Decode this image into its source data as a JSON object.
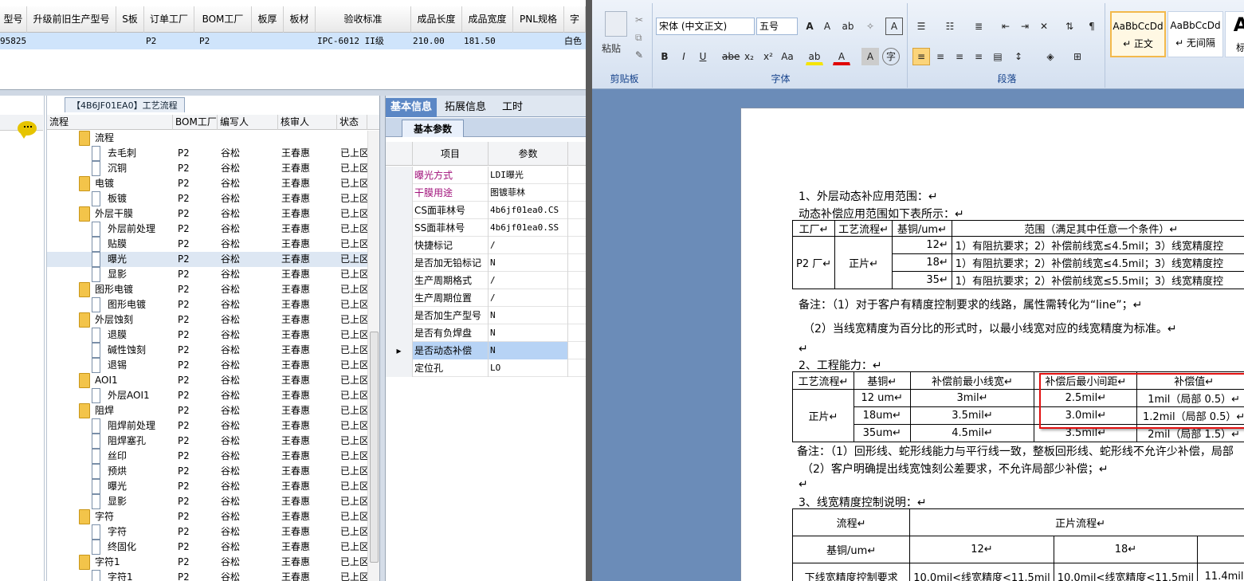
{
  "top_grid": {
    "columns": [
      "型号",
      "升级前旧生产型号",
      "S板",
      "订单工厂",
      "BOM工厂",
      "板厚",
      "板材",
      "验收标准",
      "成品长度",
      "成品宽度",
      "PNL规格",
      "字"
    ],
    "row": {
      "col0": "95825",
      "s_board": "",
      "order_factory": "P2",
      "bom_factory": "P2",
      "standard": "IPC-6012 II级",
      "length": "210.00",
      "width": "181.50",
      "tail": "白色"
    }
  },
  "process_tree": {
    "tab_title": "【4B6JF01EA0】工艺流程",
    "columns": [
      "流程",
      "BOM工厂",
      "编写人",
      "核审人",
      "状态"
    ],
    "rows": [
      {
        "name": "流程",
        "level": 0,
        "folder": true,
        "bom": "",
        "writer": "",
        "checker": "",
        "status": ""
      },
      {
        "name": "去毛刺",
        "level": 1,
        "folder": false,
        "bom": "P2",
        "writer": "谷松",
        "checker": "王春惠",
        "status": "已上区"
      },
      {
        "name": "沉铜",
        "level": 1,
        "folder": false,
        "bom": "P2",
        "writer": "谷松",
        "checker": "王春惠",
        "status": "已上区"
      },
      {
        "name": "电镀",
        "level": 0,
        "folder": true,
        "bom": "P2",
        "writer": "谷松",
        "checker": "王春惠",
        "status": "已上区"
      },
      {
        "name": "板镀",
        "level": 1,
        "folder": false,
        "bom": "P2",
        "writer": "谷松",
        "checker": "王春惠",
        "status": "已上区"
      },
      {
        "name": "外层干膜",
        "level": 0,
        "folder": true,
        "bom": "P2",
        "writer": "谷松",
        "checker": "王春惠",
        "status": "已上区"
      },
      {
        "name": "外层前处理",
        "level": 1,
        "folder": false,
        "bom": "P2",
        "writer": "谷松",
        "checker": "王春惠",
        "status": "已上区"
      },
      {
        "name": "贴膜",
        "level": 1,
        "folder": false,
        "bom": "P2",
        "writer": "谷松",
        "checker": "王春惠",
        "status": "已上区"
      },
      {
        "name": "曝光",
        "level": 1,
        "folder": false,
        "bom": "P2",
        "writer": "谷松",
        "checker": "王春惠",
        "status": "已上区",
        "selected": true
      },
      {
        "name": "显影",
        "level": 1,
        "folder": false,
        "bom": "P2",
        "writer": "谷松",
        "checker": "王春惠",
        "status": "已上区"
      },
      {
        "name": "图形电镀",
        "level": 0,
        "folder": true,
        "bom": "P2",
        "writer": "谷松",
        "checker": "王春惠",
        "status": "已上区"
      },
      {
        "name": "图形电镀",
        "level": 1,
        "folder": false,
        "bom": "P2",
        "writer": "谷松",
        "checker": "王春惠",
        "status": "已上区"
      },
      {
        "name": "外层蚀刻",
        "level": 0,
        "folder": true,
        "bom": "P2",
        "writer": "谷松",
        "checker": "王春惠",
        "status": "已上区"
      },
      {
        "name": "退膜",
        "level": 1,
        "folder": false,
        "bom": "P2",
        "writer": "谷松",
        "checker": "王春惠",
        "status": "已上区"
      },
      {
        "name": "碱性蚀刻",
        "level": 1,
        "folder": false,
        "bom": "P2",
        "writer": "谷松",
        "checker": "王春惠",
        "status": "已上区"
      },
      {
        "name": "退锡",
        "level": 1,
        "folder": false,
        "bom": "P2",
        "writer": "谷松",
        "checker": "王春惠",
        "status": "已上区"
      },
      {
        "name": "AOI1",
        "level": 0,
        "folder": true,
        "bom": "P2",
        "writer": "谷松",
        "checker": "王春惠",
        "status": "已上区"
      },
      {
        "name": "外层AOI1",
        "level": 1,
        "folder": false,
        "bom": "P2",
        "writer": "谷松",
        "checker": "王春惠",
        "status": "已上区"
      },
      {
        "name": "阻焊",
        "level": 0,
        "folder": true,
        "bom": "P2",
        "writer": "谷松",
        "checker": "王春惠",
        "status": "已上区"
      },
      {
        "name": "阻焊前处理",
        "level": 1,
        "folder": false,
        "bom": "P2",
        "writer": "谷松",
        "checker": "王春惠",
        "status": "已上区"
      },
      {
        "name": "阻焊塞孔",
        "level": 1,
        "folder": false,
        "bom": "P2",
        "writer": "谷松",
        "checker": "王春惠",
        "status": "已上区"
      },
      {
        "name": "丝印",
        "level": 1,
        "folder": false,
        "bom": "P2",
        "writer": "谷松",
        "checker": "王春惠",
        "status": "已上区"
      },
      {
        "name": "预烘",
        "level": 1,
        "folder": false,
        "bom": "P2",
        "writer": "谷松",
        "checker": "王春惠",
        "status": "已上区"
      },
      {
        "name": "曝光",
        "level": 1,
        "folder": false,
        "bom": "P2",
        "writer": "谷松",
        "checker": "王春惠",
        "status": "已上区"
      },
      {
        "name": "显影",
        "level": 1,
        "folder": false,
        "bom": "P2",
        "writer": "谷松",
        "checker": "王春惠",
        "status": "已上区"
      },
      {
        "name": "字符",
        "level": 0,
        "folder": true,
        "bom": "P2",
        "writer": "谷松",
        "checker": "王春惠",
        "status": "已上区"
      },
      {
        "name": "字符",
        "level": 1,
        "folder": false,
        "bom": "P2",
        "writer": "谷松",
        "checker": "王春惠",
        "status": "已上区"
      },
      {
        "name": "终固化",
        "level": 1,
        "folder": false,
        "bom": "P2",
        "writer": "谷松",
        "checker": "王春惠",
        "status": "已上区"
      },
      {
        "name": "字符1",
        "level": 0,
        "folder": true,
        "bom": "P2",
        "writer": "谷松",
        "checker": "王春惠",
        "status": "已上区"
      },
      {
        "name": "字符1",
        "level": 1,
        "folder": false,
        "bom": "P2",
        "writer": "谷松",
        "checker": "王春惠",
        "status": "已上区"
      }
    ]
  },
  "param_panel": {
    "tabs": [
      "基本信息",
      "拓展信息",
      "工时"
    ],
    "sub_tab": "基本参数",
    "columns": [
      "项目",
      "参数"
    ],
    "rows": [
      {
        "key": "曝光方式",
        "value": "LDI曝光",
        "key_color": "#a0107a"
      },
      {
        "key": "干膜用途",
        "value": "图镀菲林",
        "key_color": "#a0107a"
      },
      {
        "key": "CS面菲林号",
        "value": "4b6jf01ea0.CS"
      },
      {
        "key": "SS面菲林号",
        "value": "4b6jf01ea0.SS"
      },
      {
        "key": "快捷标记",
        "value": "/"
      },
      {
        "key": "是否加无铅标记",
        "value": "N"
      },
      {
        "key": "生产周期格式",
        "value": "/"
      },
      {
        "key": "生产周期位置",
        "value": "/"
      },
      {
        "key": "是否加生产型号",
        "value": "N"
      },
      {
        "key": "是否有负焊盘",
        "value": "N"
      },
      {
        "key": "是否动态补偿",
        "value": "N",
        "highlight": true
      },
      {
        "key": "定位孔",
        "value": "LO"
      }
    ]
  },
  "ribbon": {
    "paste_label": "粘贴",
    "clipboard_label": "剪贴板",
    "font_name": "宋体 (中文正文)",
    "font_size": "五号",
    "font_group_label": "字体",
    "paragraph_group_label": "段落",
    "styles": [
      {
        "sample": "AaBbCcDd",
        "name": "↵ 正文"
      },
      {
        "sample": "AaBbCcDd",
        "name": "↵ 无间隔"
      },
      {
        "sample": "A",
        "name": "标"
      }
    ],
    "colors": {
      "highlight": "#f5e400",
      "font_color": "#e00000"
    }
  },
  "document": {
    "h1": "1、外层动态补应用范围：↵",
    "p1": "动态补偿应用范围如下表所示：↵",
    "t1": {
      "headers": [
        "工厂↵",
        "工艺流程↵",
        "基铜/um↵",
        "范围（满足其中任意一个条件）↵"
      ],
      "factory": "P2 厂↵",
      "flow": "正片↵",
      "rows": [
        {
          "cu": "12↵",
          "range": "1）有阻抗要求；2）补偿前线宽≤4.5mil；3）线宽精度控"
        },
        {
          "cu": "18↵",
          "range": "1）有阻抗要求；2）补偿前线宽≤4.5mil；3）线宽精度控"
        },
        {
          "cu": "35↵",
          "range": "1）有阻抗要求；2）补偿前线宽≤5.5mil；3）线宽精度控"
        }
      ]
    },
    "note1": "备注：（1）对于客户有精度控制要求的线路，属性需转化为“line”；↵",
    "note2": "（2）当线宽精度为百分比的形式时，以最小线宽对应的线宽精度为标准。↵",
    "blank": "↵",
    "h2": "2、工程能力：↵",
    "t2": {
      "headers": [
        "工艺流程↵",
        "基铜↵",
        "补偿前最小线宽↵",
        "补偿后最小间距↵",
        "补偿值↵"
      ],
      "flow": "正片↵",
      "rows": [
        {
          "cu": "12 um↵",
          "min_w": "3mil↵",
          "min_s": "2.5mil↵",
          "comp": "1mil（局部 0.5）↵"
        },
        {
          "cu": "18um↵",
          "min_w": "3.5mil↵",
          "min_s": "3.0mil↵",
          "comp": "1.2mil（局部 0.5）↵"
        },
        {
          "cu": "35um↵",
          "min_w": "4.5mil↵",
          "min_s": "3.5mil↵",
          "comp": "2mil（局部 1.5）↵"
        }
      ]
    },
    "note3": "备注：（1）回形线、蛇形线能力与平行线一致，整板回形线、蛇形线不允许少补偿，局部",
    "note4": "（2）客户明确提出线宽蚀刻公差要求，不允许局部少补偿；↵",
    "h3": "3、线宽精度控制说明：↵",
    "t3": {
      "r1": [
        "流程↵",
        "正片流程↵"
      ],
      "r2": [
        "基铜/um↵",
        "12↵",
        "18↵"
      ],
      "r3": [
        "下线宽精度控制要求",
        "10.0mil<线宽精度<11.5mil",
        "10.0mil<线宽精度<11.5mil",
        "11.4mil"
      ]
    }
  }
}
